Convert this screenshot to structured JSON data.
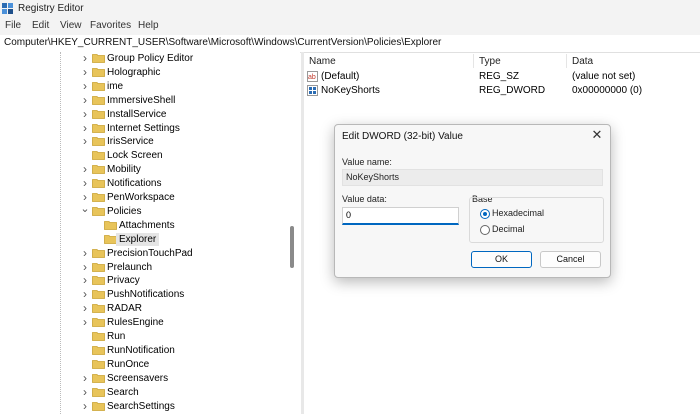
{
  "window": {
    "title": "Registry Editor"
  },
  "menu": [
    "File",
    "Edit",
    "View",
    "Favorites",
    "Help"
  ],
  "address": "Computer\\HKEY_CURRENT_USER\\Software\\Microsoft\\Windows\\CurrentVersion\\Policies\\Explorer",
  "tree": [
    {
      "label": "Group Policy Editor",
      "expander": "collapsed",
      "level": 0
    },
    {
      "label": "Holographic",
      "expander": "collapsed",
      "level": 0
    },
    {
      "label": "ime",
      "expander": "collapsed",
      "level": 0
    },
    {
      "label": "ImmersiveShell",
      "expander": "collapsed",
      "level": 0
    },
    {
      "label": "InstallService",
      "expander": "collapsed",
      "level": 0
    },
    {
      "label": "Internet Settings",
      "expander": "collapsed",
      "level": 0
    },
    {
      "label": "IrisService",
      "expander": "collapsed",
      "level": 0
    },
    {
      "label": "Lock Screen",
      "expander": "none",
      "level": 0
    },
    {
      "label": "Mobility",
      "expander": "collapsed",
      "level": 0
    },
    {
      "label": "Notifications",
      "expander": "collapsed",
      "level": 0
    },
    {
      "label": "PenWorkspace",
      "expander": "collapsed",
      "level": 0
    },
    {
      "label": "Policies",
      "expander": "expanded",
      "level": 0
    },
    {
      "label": "Attachments",
      "expander": "none",
      "level": 1
    },
    {
      "label": "Explorer",
      "expander": "none",
      "level": 1,
      "selected": true
    },
    {
      "label": "PrecisionTouchPad",
      "expander": "collapsed",
      "level": 0
    },
    {
      "label": "Prelaunch",
      "expander": "collapsed",
      "level": 0
    },
    {
      "label": "Privacy",
      "expander": "collapsed",
      "level": 0
    },
    {
      "label": "PushNotifications",
      "expander": "collapsed",
      "level": 0
    },
    {
      "label": "RADAR",
      "expander": "collapsed",
      "level": 0
    },
    {
      "label": "RulesEngine",
      "expander": "collapsed",
      "level": 0
    },
    {
      "label": "Run",
      "expander": "none",
      "level": 0
    },
    {
      "label": "RunNotification",
      "expander": "none",
      "level": 0
    },
    {
      "label": "RunOnce",
      "expander": "none",
      "level": 0
    },
    {
      "label": "Screensavers",
      "expander": "collapsed",
      "level": 0
    },
    {
      "label": "Search",
      "expander": "collapsed",
      "level": 0
    },
    {
      "label": "SearchSettings",
      "expander": "collapsed",
      "level": 0
    }
  ],
  "list": {
    "headers": {
      "name": "Name",
      "type": "Type",
      "data": "Data"
    },
    "rows": [
      {
        "name": "(Default)",
        "type": "REG_SZ",
        "data": "(value not set)",
        "icon": "string-value-icon"
      },
      {
        "name": "NoKeyShorts",
        "type": "REG_DWORD",
        "data": "0x00000000 (0)",
        "icon": "binary-value-icon"
      }
    ]
  },
  "dialog": {
    "title": "Edit DWORD (32-bit) Value",
    "value_name_label": "Value name:",
    "value_name": "NoKeyShorts",
    "value_data_label": "Value data:",
    "value_data": "0",
    "base_label": "Base",
    "radio_hex": "Hexadecimal",
    "radio_dec": "Decimal",
    "ok": "OK",
    "cancel": "Cancel"
  },
  "colors": {
    "accent": "#0067c0",
    "folder": "#e8c45a"
  }
}
